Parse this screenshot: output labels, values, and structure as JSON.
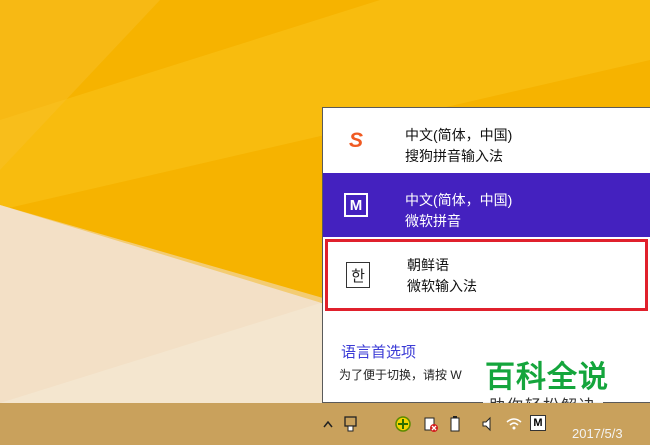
{
  "flyout": {
    "items": [
      {
        "icon": "sogou-pinyin-icon",
        "line1": "中文(简体，中国)",
        "line2": "搜狗拼音输入法"
      },
      {
        "icon": "microsoft-pinyin-icon",
        "glyph": "M",
        "line1": "中文(简体，中国)",
        "line2": "微软拼音",
        "selected": true
      },
      {
        "icon": "korean-ime-icon",
        "glyph": "한",
        "line1": "朝鲜语",
        "line2": "微软输入法",
        "highlighted": true
      }
    ],
    "preferences_link": "语言首选项",
    "hint": "为了便于切换，请按 W"
  },
  "watermark": {
    "title": "百科全说",
    "subtitle": "助你轻松解决"
  },
  "taskbar": {
    "date": "2017/5/3",
    "ime_indicator": "M"
  },
  "colors": {
    "desktop_yellow": "#f5b400",
    "selected_item": "#4421bf",
    "highlight_border": "#e0202c",
    "link": "#3b3bd6",
    "watermark_green": "#14a53c"
  }
}
